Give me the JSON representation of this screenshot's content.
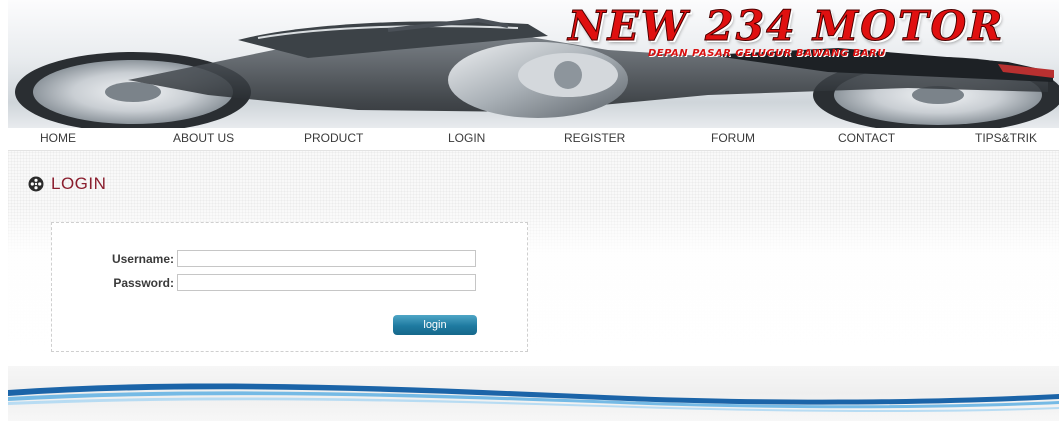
{
  "header": {
    "logo_title": "NEW 234 MOTOR",
    "logo_tagline": "DEPAN PASAR GELUGUR BAWANG BARU"
  },
  "nav": {
    "items": [
      {
        "label": "HOME"
      },
      {
        "label": "ABOUT US"
      },
      {
        "label": "PRODUCT"
      },
      {
        "label": "LOGIN"
      },
      {
        "label": "REGISTER"
      },
      {
        "label": "FORUM"
      },
      {
        "label": "CONTACT"
      },
      {
        "label": "TIPS&TRIK"
      }
    ]
  },
  "section": {
    "title": "LOGIN"
  },
  "login_form": {
    "username_label": "Username:",
    "username_value": "",
    "password_label": "Password:",
    "password_value": "",
    "submit_label": "login"
  },
  "colors": {
    "logo_red": "#e01010",
    "section_title": "#8a1e2e",
    "button_blue": "#1e7aa0"
  }
}
